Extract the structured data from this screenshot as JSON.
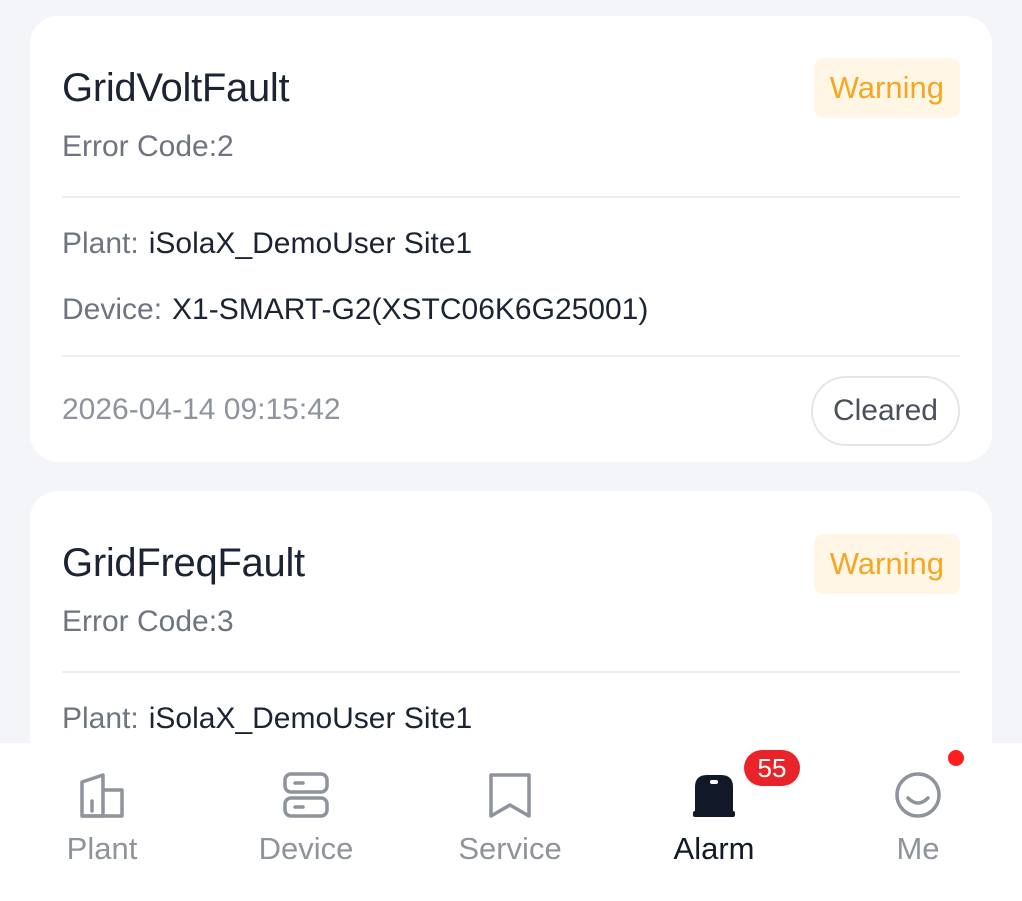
{
  "alarms": [
    {
      "title": "GridVoltFault",
      "level": "Warning",
      "error_code": "Error Code:2",
      "plant_label": "Plant:",
      "plant_value": "iSolaX_DemoUser Site1",
      "device_label": "Device:",
      "device_value": "X1-SMART-G2(XSTC06K6G25001)",
      "timestamp": "2026-04-14 09:15:42",
      "status": "Cleared"
    },
    {
      "title": "GridFreqFault",
      "level": "Warning",
      "error_code": "Error Code:3",
      "plant_label": "Plant:",
      "plant_value": "iSolaX_DemoUser Site1"
    }
  ],
  "tabbar": {
    "tabs": [
      {
        "label": "Plant",
        "icon": "plant-icon"
      },
      {
        "label": "Device",
        "icon": "device-icon"
      },
      {
        "label": "Service",
        "icon": "service-icon"
      },
      {
        "label": "Alarm",
        "icon": "alarm-icon",
        "active": true
      },
      {
        "label": "Me",
        "icon": "me-icon"
      }
    ],
    "alarm_badge": "55",
    "me_dot": true
  },
  "colors": {
    "warning": "#f5a623",
    "warning_bg": "#fff6e6",
    "badge": "#e8242a",
    "active_tab": "#111827",
    "inactive_tab": "#8e939c"
  }
}
